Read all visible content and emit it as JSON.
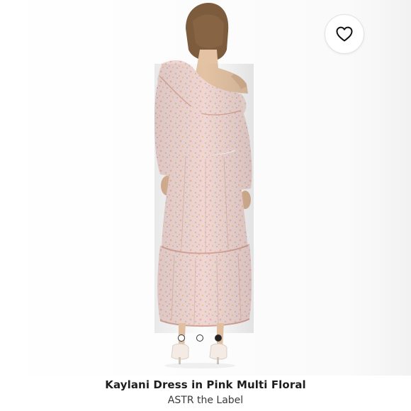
{
  "product": {
    "title": "Kaylani Dress in Pink Multi Floral",
    "brand": "ASTR the Label"
  },
  "favorite": {
    "icon": "heart-outline-icon"
  },
  "carousel": {
    "total_images": 3,
    "active_index": 3
  },
  "colors": {
    "dress": "#efd3d0",
    "hair": "#7a5a3c",
    "skin": "#e3c1a2",
    "background": "#ffffff"
  }
}
